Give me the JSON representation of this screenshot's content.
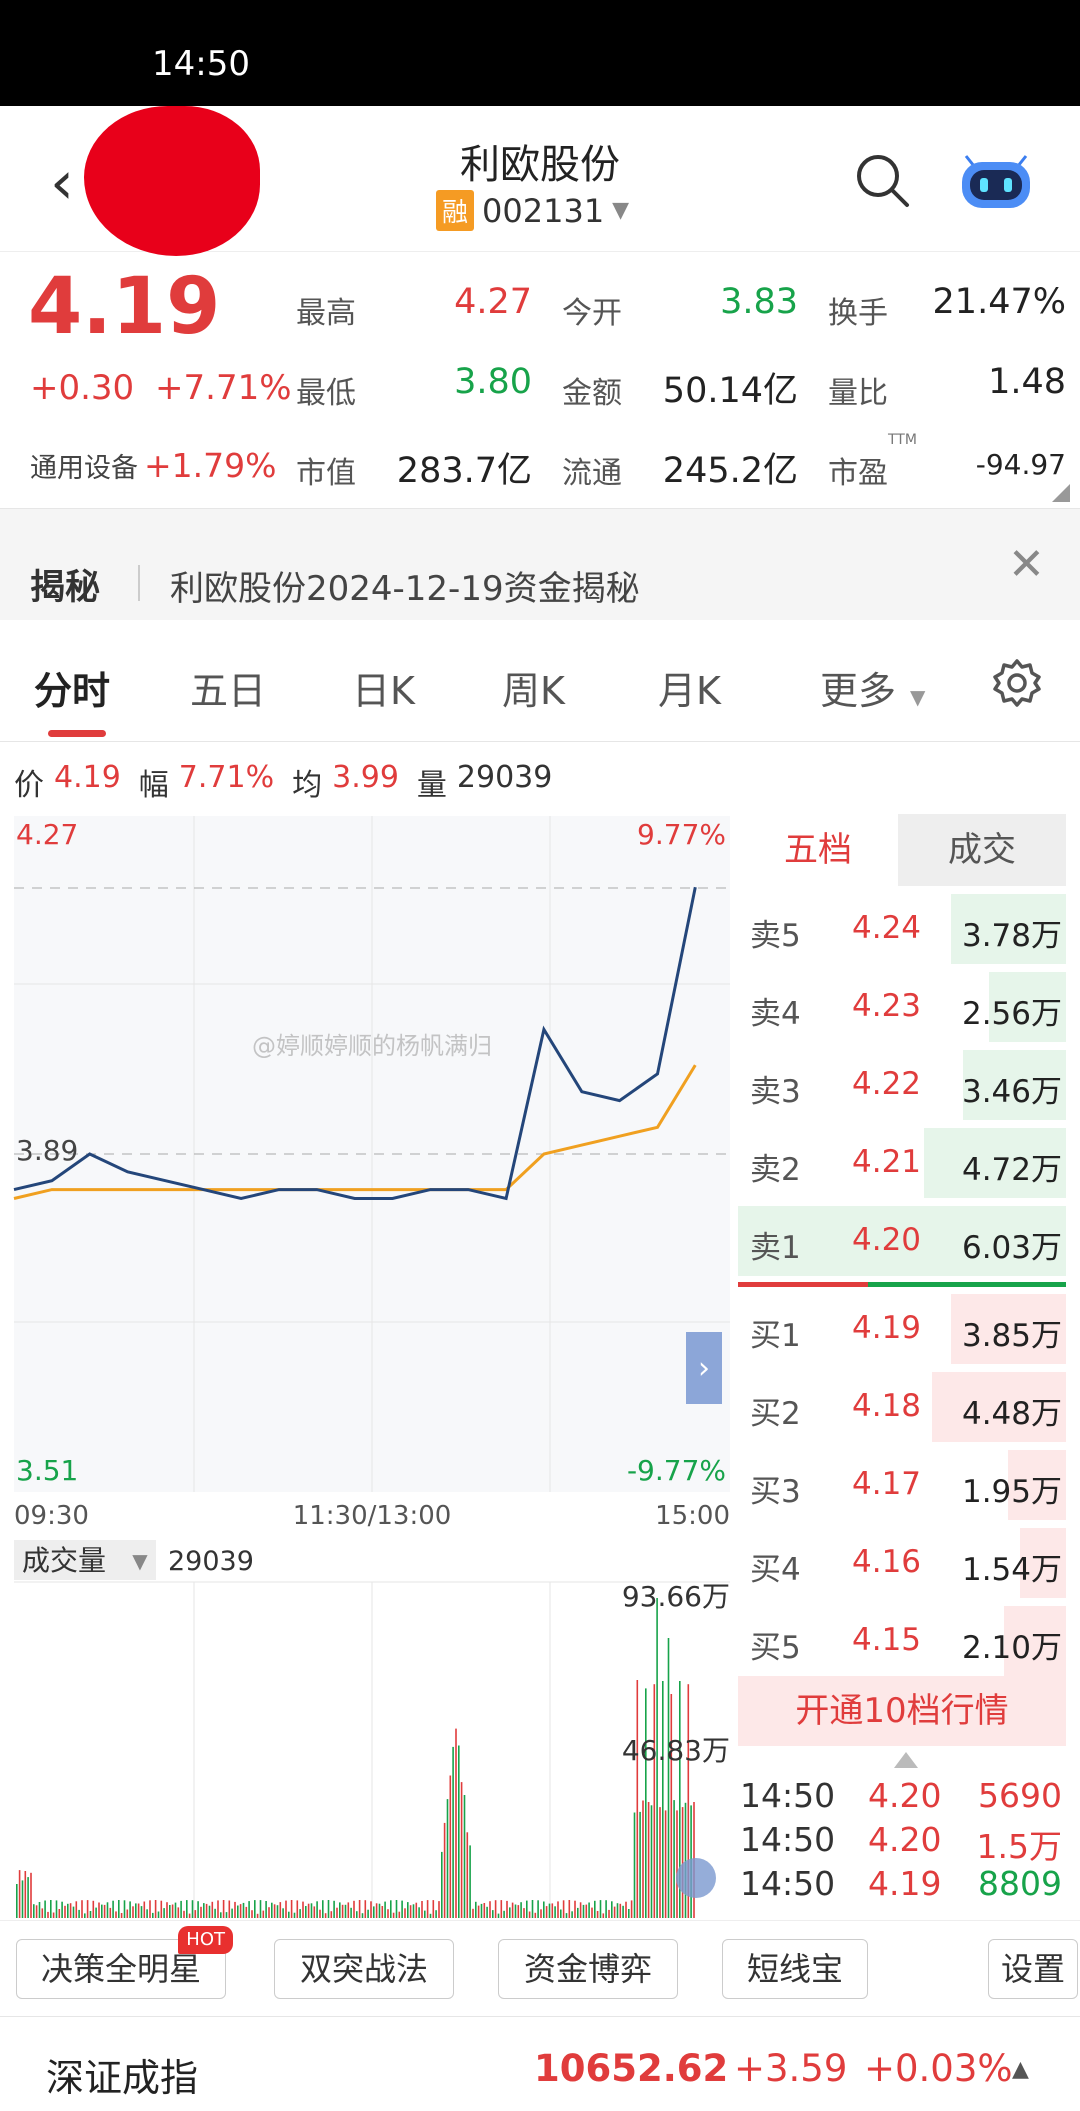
{
  "status_bar": {
    "time": "14:50"
  },
  "header": {
    "title": "利欧股份",
    "margin_badge": "融",
    "code": "002131"
  },
  "quote": {
    "price": "4.19",
    "change": "+0.30",
    "change_pct": "+7.71%",
    "sector_name": "通用设备",
    "sector_pct": "+1.79%",
    "fields": [
      {
        "label": "最高",
        "value": "4.27",
        "color": "red"
      },
      {
        "label": "今开",
        "value": "3.83",
        "color": "green"
      },
      {
        "label": "换手",
        "value": "21.47%",
        "color": "dark"
      },
      {
        "label": "最低",
        "value": "3.80",
        "color": "green"
      },
      {
        "label": "金额",
        "value": "50.14亿",
        "color": "dark"
      },
      {
        "label": "量比",
        "value": "1.48",
        "color": "dark"
      },
      {
        "label": "市值",
        "value": "283.7亿",
        "color": "dark"
      },
      {
        "label": "流通",
        "value": "245.2亿",
        "color": "dark"
      },
      {
        "label": "市盈",
        "value": "-94.97",
        "color": "dark"
      }
    ],
    "pe_sup": "TTM"
  },
  "reveal": {
    "label": "揭秘",
    "text": "利欧股份2024-12-19资金揭秘"
  },
  "tabs": [
    "分时",
    "五日",
    "日K",
    "周K",
    "月K",
    "更多"
  ],
  "chart_info": {
    "price_label": "价",
    "price": "4.19",
    "amp_label": "幅",
    "amp": "7.71%",
    "avg_label": "均",
    "avg": "3.99",
    "vol_label": "量",
    "vol": "29039"
  },
  "chart_labels": {
    "top_price": "4.27",
    "top_pct": "9.77%",
    "mid_price": "3.89",
    "bottom_price": "3.51",
    "bottom_pct": "-9.77%",
    "t_start": "09:30",
    "t_mid": "11:30/13:00",
    "t_end": "15:00",
    "vol_title": "成交量",
    "vol_value": "29039",
    "vol_max": "93.66万",
    "vol_mid": "46.83万",
    "watermark": "@婷顺婷顺的杨帆满归"
  },
  "chart_data": {
    "type": "line",
    "title": "",
    "x": [
      "09:30",
      "09:45",
      "10:00",
      "10:15",
      "10:30",
      "10:45",
      "11:00",
      "11:15",
      "11:30/13:00",
      "13:15",
      "13:30",
      "13:45",
      "14:00",
      "14:15",
      "14:30",
      "14:35",
      "14:40",
      "14:45",
      "14:50"
    ],
    "series": [
      {
        "values": [
          3.85,
          3.86,
          3.89,
          3.87,
          3.86,
          3.85,
          3.84,
          3.85,
          3.85,
          3.84,
          3.84,
          3.85,
          3.85,
          3.84,
          4.03,
          3.96,
          3.95,
          3.98,
          4.19
        ]
      },
      {
        "values": [
          3.84,
          3.85,
          3.85,
          3.85,
          3.85,
          3.85,
          3.85,
          3.85,
          3.85,
          3.85,
          3.85,
          3.85,
          3.85,
          3.85,
          3.89,
          3.9,
          3.91,
          3.92,
          3.99
        ]
      }
    ],
    "ylim": [
      3.51,
      4.27
    ],
    "reference": 3.89,
    "volume_ylim": [
      0,
      936600
    ]
  },
  "order_book": {
    "tab_active": "五档",
    "tab_other": "成交",
    "asks": [
      {
        "label": "卖5",
        "price": "4.24",
        "vol": "3.78万",
        "depth": 0.48
      },
      {
        "label": "卖4",
        "price": "4.23",
        "vol": "2.56万",
        "depth": 0.32
      },
      {
        "label": "卖3",
        "price": "4.22",
        "vol": "3.46万",
        "depth": 0.43
      },
      {
        "label": "卖2",
        "price": "4.21",
        "vol": "4.72万",
        "depth": 0.59
      },
      {
        "label": "卖1",
        "price": "4.20",
        "vol": "6.03万",
        "depth": 1.0
      }
    ],
    "bids": [
      {
        "label": "买1",
        "price": "4.19",
        "vol": "3.85万",
        "depth": 0.48
      },
      {
        "label": "买2",
        "price": "4.18",
        "vol": "4.48万",
        "depth": 0.56
      },
      {
        "label": "买3",
        "price": "4.17",
        "vol": "1.95万",
        "depth": 0.24
      },
      {
        "label": "买4",
        "price": "4.16",
        "vol": "1.54万",
        "depth": 0.19
      },
      {
        "label": "买5",
        "price": "4.15",
        "vol": "2.10万",
        "depth": 0.26
      }
    ],
    "open_10": "开通10档行情",
    "ticks": [
      {
        "time": "14:50",
        "price": "4.20",
        "vol": "5690",
        "color": "red"
      },
      {
        "time": "14:50",
        "price": "4.20",
        "vol": "1.5万",
        "color": "red"
      },
      {
        "time": "14:50",
        "price": "4.19",
        "vol": "8809",
        "color": "green"
      }
    ]
  },
  "tools": {
    "t1": "决策全明星",
    "hot": "HOT",
    "t2": "双突战法",
    "t3": "资金博弈",
    "t4": "短线宝",
    "settings": "设置"
  },
  "footer": {
    "index_name": "深证成指",
    "value": "10652.62",
    "change": "+3.59",
    "pct": "+0.03%"
  }
}
